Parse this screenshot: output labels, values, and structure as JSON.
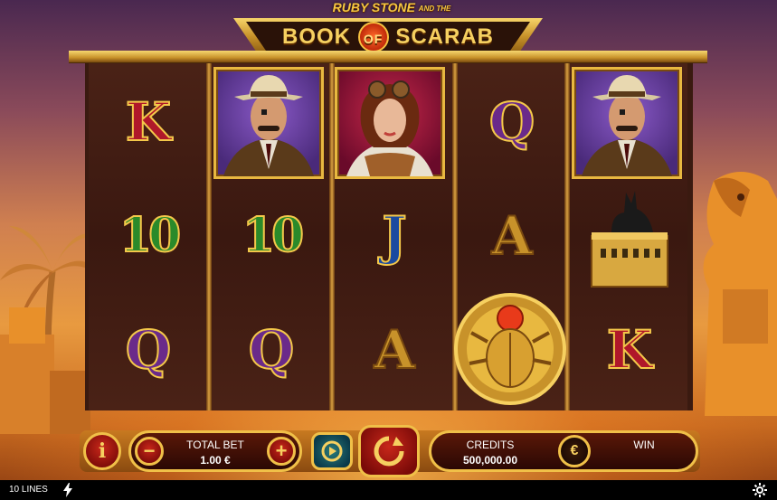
{
  "logo": {
    "top_line_1": "RUBY STONE",
    "top_line_2": "AND THE",
    "title_left": "BOOK",
    "title_of": "OF",
    "title_right": "SCARAB"
  },
  "reels": [
    [
      "K",
      "10",
      "Q"
    ],
    [
      "detective",
      "10",
      "Q"
    ],
    [
      "ruby",
      "J",
      "A"
    ],
    [
      "Q",
      "A",
      "scarab"
    ],
    [
      "detective",
      "anubis",
      "K"
    ]
  ],
  "controls": {
    "info_label": "i",
    "minus_label": "−",
    "plus_label": "+",
    "total_bet_label": "TOTAL BET",
    "total_bet_value": "1.00 €",
    "credits_label": "CREDITS",
    "credits_value": "500,000.00",
    "currency_symbol": "€",
    "win_label": "WIN"
  },
  "statusbar": {
    "lines": "10 LINES"
  },
  "colors": {
    "gold": "#f0c048",
    "red_button": "#c8281a",
    "dark_pill": "#2a0804"
  }
}
